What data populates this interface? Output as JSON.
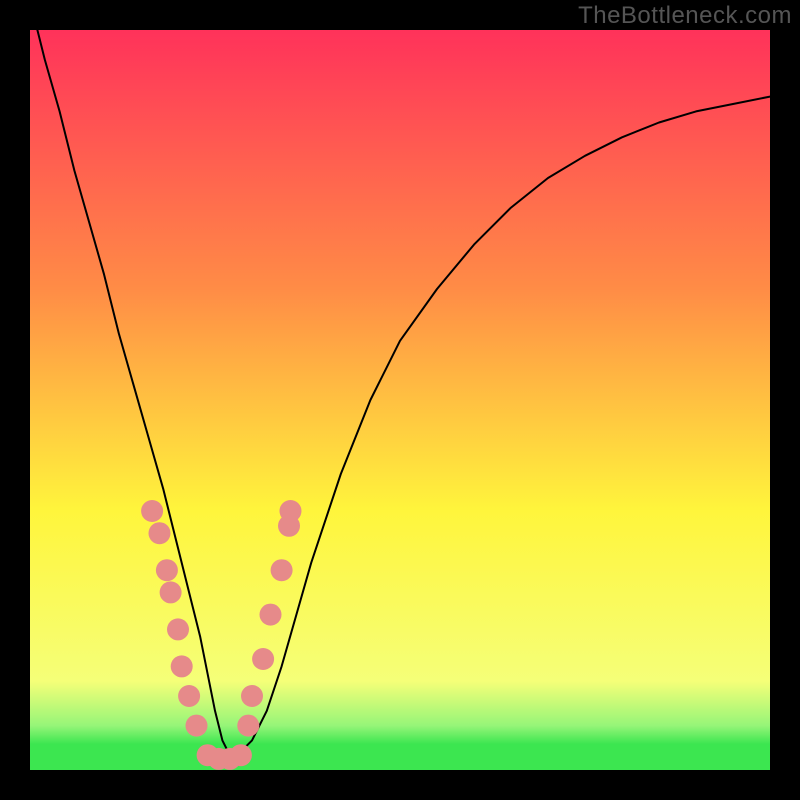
{
  "watermark": "TheBottleneck.com",
  "chart_data": {
    "type": "line",
    "title": "",
    "xlabel": "",
    "ylabel": "",
    "xlim": [
      0,
      100
    ],
    "ylim": [
      0,
      100
    ],
    "series": [
      {
        "name": "bottleneck-curve",
        "x": [
          1,
          2,
          4,
          6,
          8,
          10,
          12,
          14,
          16,
          18,
          20,
          22,
          23,
          24,
          25,
          26,
          27,
          28,
          30,
          32,
          34,
          36,
          38,
          42,
          46,
          50,
          55,
          60,
          65,
          70,
          75,
          80,
          85,
          90,
          95,
          100
        ],
        "y": [
          100,
          96,
          89,
          81,
          74,
          67,
          59,
          52,
          45,
          38,
          30,
          22,
          18,
          13,
          8,
          4,
          2,
          2,
          4,
          8,
          14,
          21,
          28,
          40,
          50,
          58,
          65,
          71,
          76,
          80,
          83,
          85.5,
          87.5,
          89,
          90,
          91
        ],
        "stroke": "#000000",
        "stroke_width": 2
      }
    ],
    "markers": {
      "name": "optimum-cluster",
      "color": "#e68a8a",
      "radius": 11,
      "points": [
        {
          "x": 16.5,
          "y": 35
        },
        {
          "x": 17.5,
          "y": 32
        },
        {
          "x": 18.5,
          "y": 27
        },
        {
          "x": 19.0,
          "y": 24
        },
        {
          "x": 20.0,
          "y": 19
        },
        {
          "x": 20.5,
          "y": 14
        },
        {
          "x": 21.5,
          "y": 10
        },
        {
          "x": 22.5,
          "y": 6
        },
        {
          "x": 24.0,
          "y": 2
        },
        {
          "x": 25.5,
          "y": 1.5
        },
        {
          "x": 27.0,
          "y": 1.5
        },
        {
          "x": 28.5,
          "y": 2
        },
        {
          "x": 29.5,
          "y": 6
        },
        {
          "x": 30.0,
          "y": 10
        },
        {
          "x": 31.5,
          "y": 15
        },
        {
          "x": 32.5,
          "y": 21
        },
        {
          "x": 34.0,
          "y": 27
        },
        {
          "x": 35.0,
          "y": 33
        },
        {
          "x": 35.2,
          "y": 35
        }
      ]
    },
    "gradient_bands_pct": {
      "green": 3.5,
      "lightgreen": 6,
      "paleyellow": 12,
      "yellow": 35,
      "orange": 65,
      "red": 100
    }
  }
}
